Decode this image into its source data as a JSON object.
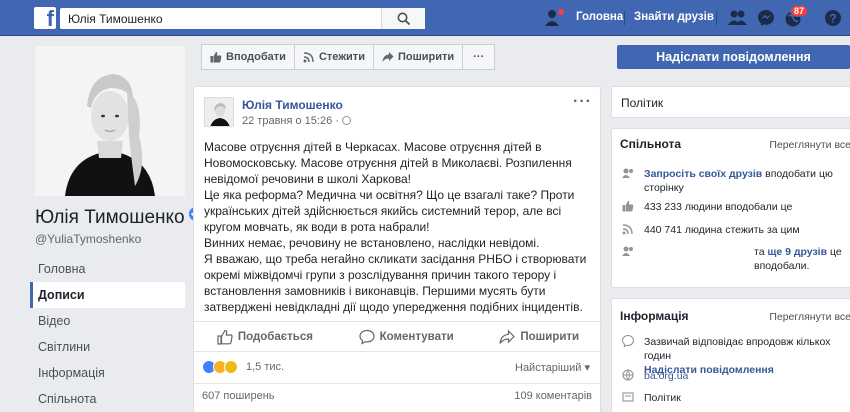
{
  "topbar": {
    "search_value": "Юлія Тимошенко",
    "home": "Головна",
    "find_friends": "Знайти друзів",
    "notif_count": "87"
  },
  "page": {
    "name": "Юлія Тимошенко",
    "handle": "@YuliaTymoshenko"
  },
  "left_nav": [
    "Головна",
    "Дописи",
    "Відео",
    "Світлини",
    "Інформація",
    "Спільнота"
  ],
  "actions": {
    "like": "Вподобати",
    "follow": "Стежити",
    "share": "Поширити",
    "more": "···",
    "send_message": "Надіслати повідомлення"
  },
  "post": {
    "author": "Юлія Тимошенко",
    "date": "22 травня о 15:26 · ",
    "paragraphs": [
      "Масове отруєння дітей в Черкасах. Масове отруєння дітей в Новомосковську. Масове отруєння дітей в Миколаєві. Розпилення невідомої речовини в школі Харкова!",
      "Це яка реформа? Медична чи освітня? Що це взагалі таке? Проти українських дітей здійснюється якийсь системний терор, але всі кругом мовчать, як води в рота набрали!",
      "Винних немає, речовину не встановлено, наслідки невідомі.",
      "Я вважаю, що треба негайно скликати засідання РНБО і створювати окремі міжвідомчі групи з розслідування причин такого терору і встановлення замовників і виконавців. Першими мусять бути затверджені невідкладні дії щодо упередження подібних інцидентів."
    ],
    "like_label": "Подобається",
    "comment_label": "Коментувати",
    "share_label": "Поширити",
    "reactions_count": "1,5 тис.",
    "sort_label": "Найстаріший ▾",
    "shares": "607 поширень",
    "comments": "109 коментарів"
  },
  "right": {
    "category": "Політик",
    "community": {
      "title": "Спільнота",
      "see_all": "Переглянути все",
      "invite_link": "Запросіть своїх друзів",
      "invite_rest": " вподобати цю сторінку",
      "likes": "433 233 людини вподобали це",
      "follows": "440 741 людина стежить за цим",
      "friends_prefix": "та ",
      "friends_link": "ще 9 друзів",
      "friends_rest": " це вподобали."
    },
    "info": {
      "title": "Інформація",
      "see_all": "Переглянути все",
      "response": "Зазвичай відповідає впродовж кількох годин",
      "send_message": "Надіслати повідомлення",
      "website": "ba.org.ua",
      "category": "Політик"
    }
  }
}
